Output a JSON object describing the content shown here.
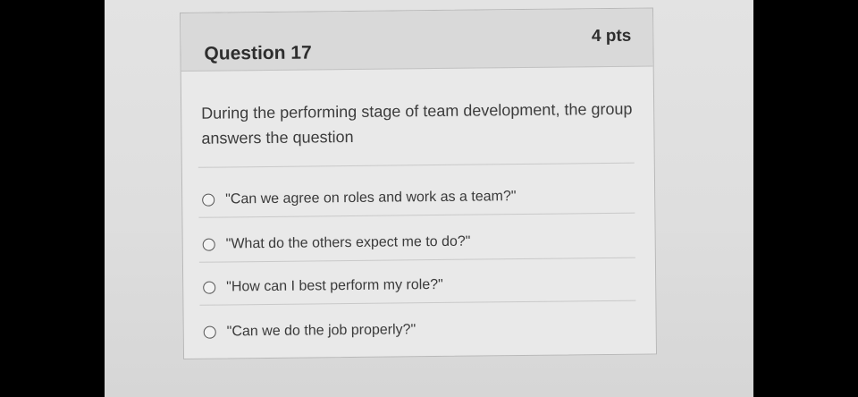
{
  "question": {
    "title": "Question 17",
    "points": "4 pts",
    "text": "During the performing stage of team development, the group answers the question"
  },
  "answers": [
    {
      "label": "\"Can we agree on roles and work as a team?\"",
      "selected": false
    },
    {
      "label": "\"What do the others expect me to do?\"",
      "selected": false
    },
    {
      "label": "\"How can I best perform my role?\"",
      "selected": false
    },
    {
      "label": "\"Can we do the job properly?\"",
      "selected": false
    }
  ],
  "icons": {
    "flag": "bookmark-flag-icon",
    "radio": "radio-button-icon"
  },
  "colors": {
    "background": "#000000",
    "card": "#e9e9e9",
    "header": "#d9d9d9",
    "text": "#2e2e2e"
  }
}
